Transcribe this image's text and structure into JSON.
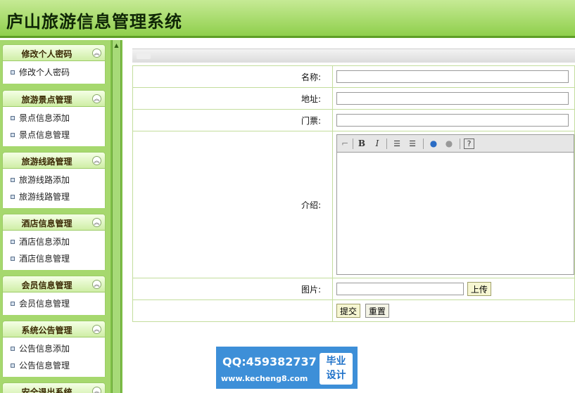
{
  "header": {
    "title": "庐山旅游信息管理系统"
  },
  "sidebar": {
    "collapse_glyph": "︽",
    "groups": [
      {
        "title": "修改个人密码",
        "items": [
          "修改个人密码"
        ]
      },
      {
        "title": "旅游景点管理",
        "items": [
          "景点信息添加",
          "景点信息管理"
        ]
      },
      {
        "title": "旅游线路管理",
        "items": [
          "旅游线路添加",
          "旅游线路管理"
        ]
      },
      {
        "title": "酒店信息管理",
        "items": [
          "酒店信息添加",
          "酒店信息管理"
        ]
      },
      {
        "title": "会员信息管理",
        "items": [
          "会员信息管理"
        ]
      },
      {
        "title": "系统公告管理",
        "items": [
          "公告信息添加",
          "公告信息管理"
        ]
      },
      {
        "title": "安全退出系统",
        "items": []
      }
    ]
  },
  "form": {
    "name_label": "名称:",
    "address_label": "地址:",
    "ticket_label": "门票:",
    "intro_label": "介绍:",
    "image_label": "图片:",
    "upload_label": "上传",
    "submit_label": "提交",
    "reset_label": "重置",
    "editor_toolbar": {
      "bold": "B",
      "italic": "I",
      "help": "?"
    }
  },
  "watermark": {
    "qq": "QQ:459382737",
    "url": "www.kecheng8.com",
    "badge_line1": "毕业",
    "badge_line2": "设计"
  },
  "colors": {
    "header_green": "#8fcf4c",
    "sidebar_green": "#a6d86e",
    "table_border": "#c3dd9d",
    "watermark_blue": "#3d8fd8"
  }
}
